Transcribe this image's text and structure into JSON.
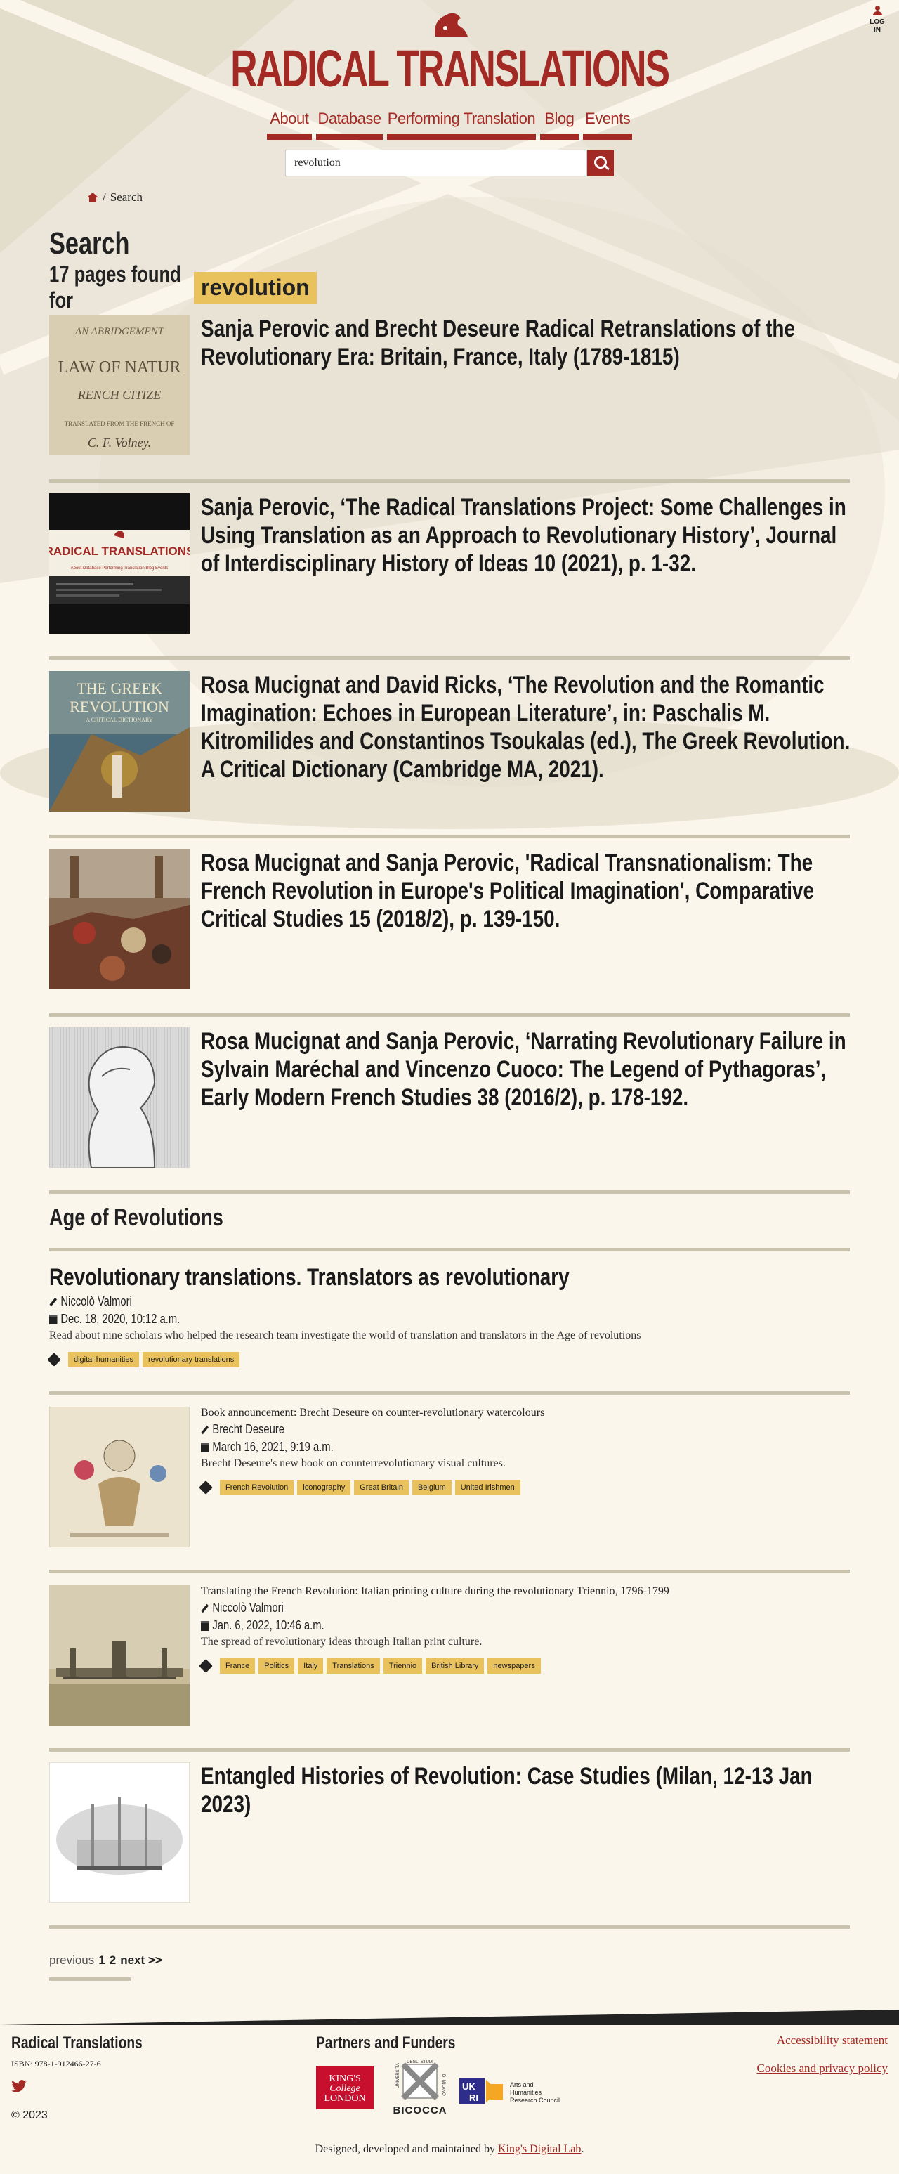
{
  "header": {
    "site_title": "RADICAL TRANSLATIONS",
    "login_label": "LOG IN",
    "nav": [
      {
        "label": "About"
      },
      {
        "label": "Database"
      },
      {
        "label": "Performing Translation"
      },
      {
        "label": "Blog"
      },
      {
        "label": "Events"
      }
    ],
    "search_value": "revolution"
  },
  "breadcrumb": {
    "current": "Search",
    "separator": "/"
  },
  "page": {
    "title": "Search",
    "found_text": "17 pages found for",
    "query": "revolution"
  },
  "results": [
    {
      "title": "Sanja Perovic and Brecht Deseure Radical Retranslations of the Revolutionary Era: Britain, France, Italy (1789-1815)",
      "thumb": "abridgement-book-cover",
      "thumb_text": [
        "AN ABRIDGEMENT",
        "LAW OF NATUR",
        "RENCH CITIZE",
        "TRANSLATED FROM THE FRENCH OF",
        "C. F. Volney."
      ]
    },
    {
      "title": "Sanja Perovic, ‘The Radical Translations Project: Some Challenges in Using Translation as an Approach to Revolutionary History’, Journal of Interdisciplinary History of Ideas 10 (2021), p. 1-32.",
      "thumb": "website-screenshot",
      "thumb_text": [
        "RADICAL TRANSLATIONS",
        "About  Database  Performing Translation  Blog  Events"
      ]
    },
    {
      "title": "Rosa Mucignat and David Ricks, ‘The Revolution and the Romantic Imagination: Echoes in European Literature’, in: Paschalis M. Kitromilides and Constantinos Tsoukalas (ed.), The Greek Revolution. A Critical Dictionary (Cambridge MA, 2021).",
      "thumb": "greek-revolution-cover",
      "thumb_text": [
        "THE GREEK",
        "REVOLUTION",
        "A CRITICAL DICTIONARY"
      ]
    },
    {
      "title": "Rosa Mucignat and Sanja Perovic, 'Radical Transnationalism: The French Revolution in Europe's Political Imagination', Comparative Critical Studies 15 (2018/2), p. 139-150.",
      "thumb": "crowd-painting",
      "thumb_text": []
    },
    {
      "title": "Rosa Mucignat and Sanja Perovic, ‘Narrating Revolutionary Failure in Sylvain Maréchal and Vincenzo Cuoco: The Legend of Pythagoras’, Early Modern French Studies 38 (2016/2), p. 178-192.",
      "thumb": "portrait-engraving",
      "thumb_text": []
    }
  ],
  "section_heading": "Age of Revolutions",
  "posts": [
    {
      "title": "Revolutionary translations. Translators as revolutionary",
      "author": "Niccolò Valmori",
      "date": "Dec. 18, 2020, 10:12 a.m.",
      "summary": "Read about nine scholars who helped the research team investigate the world of translation and translators in the Age of revolutions",
      "tags": [
        "digital humanities",
        "revolutionary translations"
      ]
    },
    {
      "title": "Book announcement: Brecht Deseure on counter-revolutionary watercolours",
      "author": "Brecht Deseure",
      "date": "March 16, 2021, 9:19 a.m.",
      "summary": "Brecht Deseure's new book on counterrevolutionary visual cultures.",
      "tags": [
        "French Revolution",
        "iconography",
        "Great Britain",
        "Belgium",
        "United Irishmen"
      ]
    },
    {
      "title": "Translating the French Revolution: Italian printing culture during the revolutionary Triennio, 1796-1799",
      "author": "Niccolò Valmori",
      "date": "Jan. 6, 2022, 10:46 a.m.",
      "summary": "The spread of revolutionary ideas through Italian print culture.",
      "tags": [
        "France",
        "Politics",
        "Italy",
        "Translations",
        "Triennio",
        "British Library",
        "newspapers"
      ]
    },
    {
      "title": "Entangled Histories of Revolution: Case Studies (Milan, 12-13 Jan 2023)"
    }
  ],
  "pager": {
    "previous": "previous",
    "pages": [
      "1",
      "2"
    ],
    "next": "next >>"
  },
  "footer": {
    "title": "Radical Translations",
    "isbn": "ISBN: 978-1-912466-27-6",
    "copyright": "© 2023",
    "partners_title": "Partners and Funders",
    "partners": {
      "kcl": [
        "KING'S",
        "College",
        "LONDON"
      ],
      "bicocca": [
        "UNIVERSITÀ",
        "DEGLI STUDI",
        "DI MILANO",
        "BICOCCA"
      ],
      "ukri": [
        "UK",
        "RI",
        "Arts and",
        "Humanities",
        "Research Council"
      ]
    },
    "links": [
      "Accessibility statement",
      "Cookies and privacy policy"
    ],
    "credit_text": "Designed, developed and maintained by",
    "credit_link": "King's Digital Lab",
    "credit_end": "."
  },
  "colors": {
    "brand": "#a32a24",
    "tag": "#e9c25e",
    "rule": "#c9c3ae",
    "background": "#faf6ec"
  }
}
